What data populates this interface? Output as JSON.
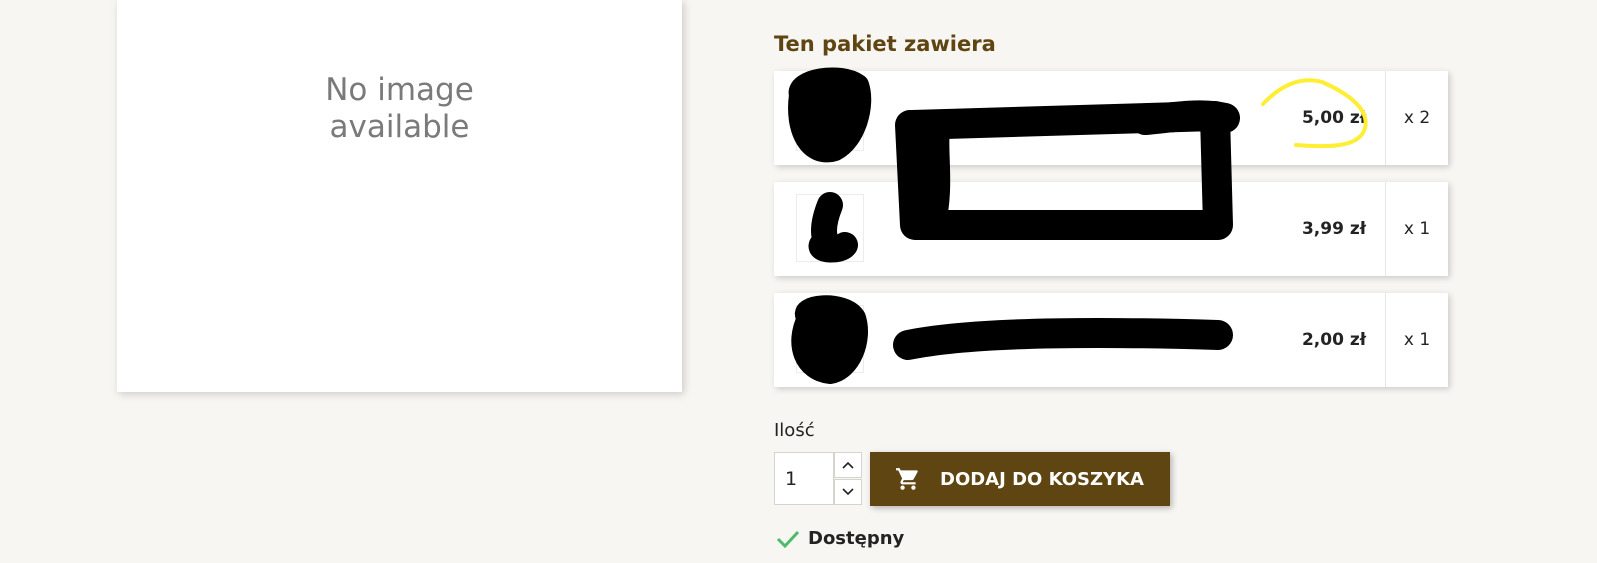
{
  "cover": {
    "no_image_text": "No image\navailable"
  },
  "pack": {
    "title": "Ten pakiet zawiera",
    "items": [
      {
        "price": "5,00 zł",
        "quantity": "x 2"
      },
      {
        "price": "3,99 zł",
        "quantity": "x 1"
      },
      {
        "price": "2,00 zł",
        "quantity": "x 1"
      }
    ]
  },
  "purchase": {
    "quantity_label": "Ilość",
    "quantity_value": "1",
    "add_to_cart_label": "DODAJ DO KOSZYKA"
  },
  "availability": {
    "label": "Dostępny"
  },
  "colors": {
    "brand": "#5e4511",
    "page_background": "#f8f6f2",
    "available_check": "#4cbb6c",
    "annotation_highlight": "#ffee33"
  },
  "icons": {
    "cart": "shopping-cart-icon",
    "quantity_up": "chevron-up-icon",
    "quantity_down": "chevron-down-icon",
    "availability": "check-icon"
  }
}
